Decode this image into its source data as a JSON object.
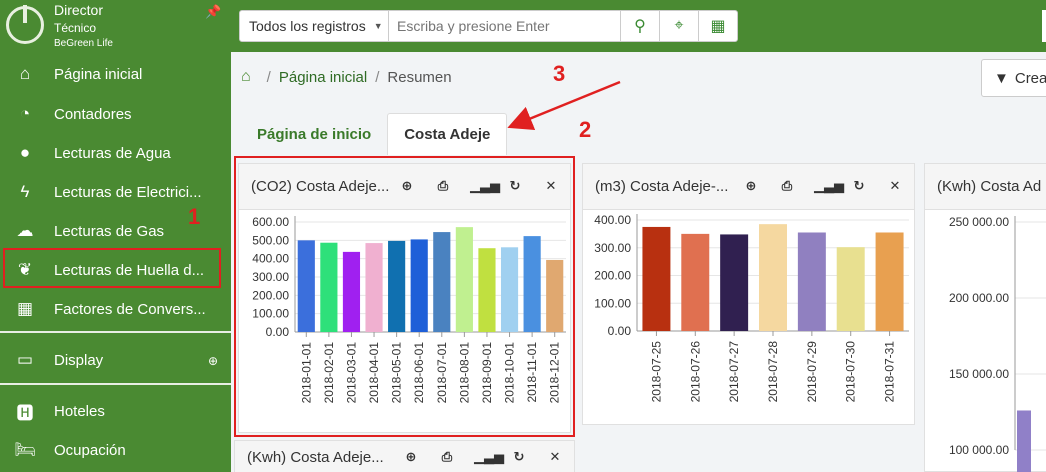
{
  "sidebar": {
    "user_role": "Director",
    "user_sub": "Técnico",
    "user_company": "BeGreen Life",
    "items": [
      {
        "label": "Página inicial",
        "icon": "home-icon"
      },
      {
        "label": "Contadores",
        "icon": "gauge-icon"
      },
      {
        "label": "Lecturas de Agua",
        "icon": "water-drop-icon"
      },
      {
        "label": "Lecturas de Electrici...",
        "icon": "bolt-icon"
      },
      {
        "label": "Lecturas de Gas",
        "icon": "cloud-icon"
      },
      {
        "label": "Lecturas de Huella d...",
        "icon": "leaf-icon"
      },
      {
        "label": "Factores de Convers...",
        "icon": "calculator-icon"
      },
      {
        "label": "Display",
        "icon": "monitor-icon"
      },
      {
        "label": "Hoteles",
        "icon": "hotel-icon"
      },
      {
        "label": "Ocupación",
        "icon": "bed-icon"
      }
    ]
  },
  "search": {
    "select_value": "Todos los registros",
    "placeholder": "Escriba y presione Enter"
  },
  "breadcrumb": {
    "home": "Página inicial",
    "current": "Resumen"
  },
  "create_button": "Crea",
  "tabs": [
    "Página de inicio",
    "Costa Adeje"
  ],
  "annotations": [
    "1",
    "2",
    "3"
  ],
  "widgets": [
    {
      "title": "(CO2) Costa Adeje..."
    },
    {
      "title": "(m3) Costa Adeje-..."
    },
    {
      "title": "(Kwh) Costa Ad"
    },
    {
      "title": "(Kwh) Costa Adeje..."
    }
  ],
  "chart_data": [
    {
      "type": "bar",
      "categories": [
        "2018-01-01",
        "2018-02-01",
        "2018-03-01",
        "2018-04-01",
        "2018-05-01",
        "2018-06-01",
        "2018-07-01",
        "2018-08-01",
        "2018-09-01",
        "2018-10-01",
        "2018-11-01",
        "2018-12-01"
      ],
      "values": [
        500,
        487,
        437,
        485,
        497,
        505,
        545,
        572,
        457,
        462,
        523,
        393
      ],
      "colors": [
        "#3b6fdc",
        "#2ee07a",
        "#a020f0",
        "#f0b0d0",
        "#1070b0",
        "#1e5fd8",
        "#4a82c0",
        "#c0f090",
        "#c0e040",
        "#a0d0f0",
        "#4a90e0",
        "#e0a870"
      ],
      "yticks": [
        "600.00",
        "500.00",
        "400.00",
        "300.00",
        "200.00",
        "100.00",
        "0.00"
      ],
      "ylim": [
        0,
        600
      ]
    },
    {
      "type": "bar",
      "categories": [
        "2018-07-25",
        "2018-07-26",
        "2018-07-27",
        "2018-07-28",
        "2018-07-29",
        "2018-07-30",
        "2018-07-31"
      ],
      "values": [
        375,
        350,
        348,
        385,
        355,
        302,
        355
      ],
      "colors": [
        "#b83010",
        "#e07050",
        "#302050",
        "#f5d8a0",
        "#9080c0",
        "#e8e090",
        "#e8a050"
      ],
      "yticks": [
        "400.00",
        "300.00",
        "200.00",
        "100.00",
        "0.00"
      ],
      "ylim": [
        0,
        400
      ]
    },
    {
      "type": "bar",
      "categories": [],
      "values": [],
      "colors": [
        "#9080c8"
      ],
      "yticks": [
        "250 000.00",
        "200 000.00",
        "150 000.00",
        "100 000.00"
      ],
      "ylim": [
        100000,
        250000
      ]
    }
  ]
}
